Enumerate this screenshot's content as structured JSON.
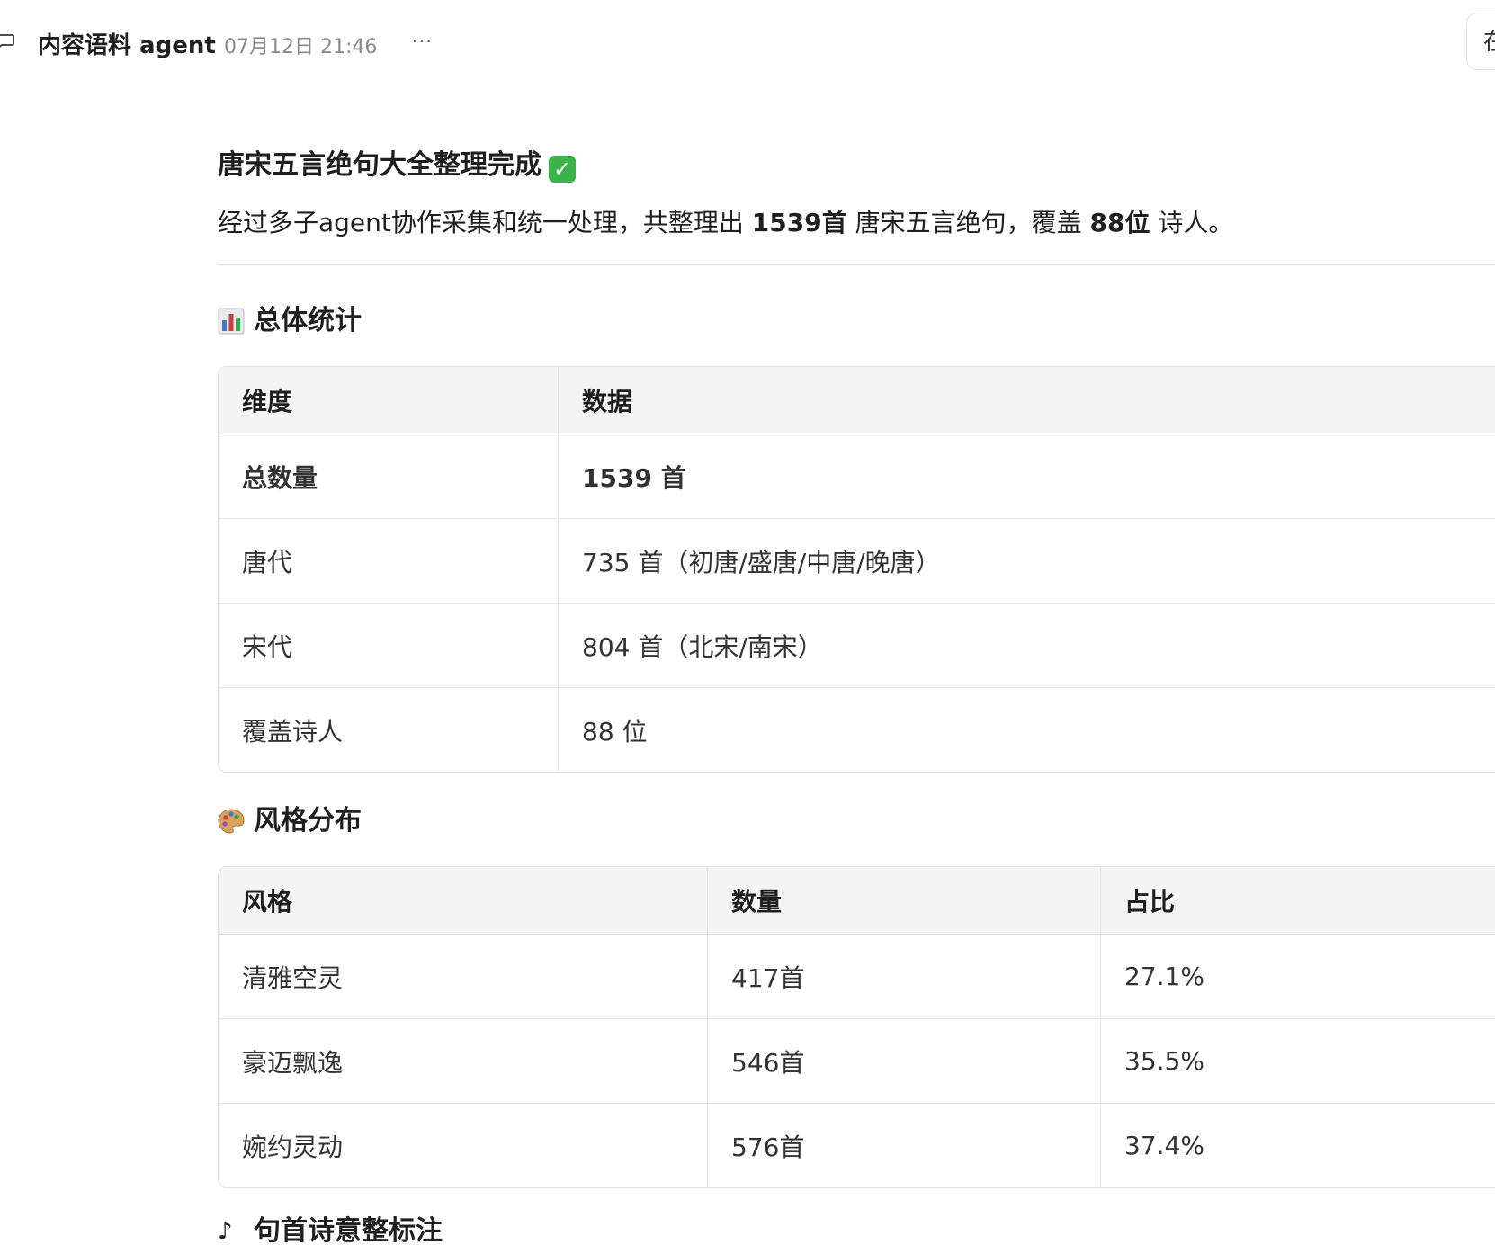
{
  "header": {
    "title": "内容语料 agent",
    "timestamp": "07月12日 21:46",
    "more_label": "···",
    "right_button_label": "在"
  },
  "message": {
    "heading": "唐宋五言绝句大全整理完成",
    "heading_emoji": "✅",
    "summary_prefix": "经过多子agent协作采集和统一处理，共整理出 ",
    "summary_count": "1539首",
    "summary_middle": " 唐宋五言绝句，覆盖 ",
    "summary_poets": "88位",
    "summary_suffix": " 诗人。"
  },
  "overview": {
    "title": "总体统计",
    "icon": "bar-chart-emoji",
    "columns": [
      "维度",
      "数据"
    ],
    "rows": [
      [
        "总数量",
        "1539 首"
      ],
      [
        "唐代",
        "735 首（初唐/盛唐/中唐/晚唐）"
      ],
      [
        "宋代",
        "804 首（北宋/南宋）"
      ],
      [
        "覆盖诗人",
        "88 位"
      ]
    ]
  },
  "styles": {
    "title": "风格分布",
    "icon": "palette-emoji",
    "columns": [
      "风格",
      "数量",
      "占比"
    ],
    "rows": [
      [
        "清雅空灵",
        "417首",
        "27.1%"
      ],
      [
        "豪迈飘逸",
        "546首",
        "35.5%"
      ],
      [
        "婉约灵动",
        "576首",
        "37.4%"
      ]
    ]
  },
  "next_section": {
    "title": "句首诗意整标注"
  }
}
